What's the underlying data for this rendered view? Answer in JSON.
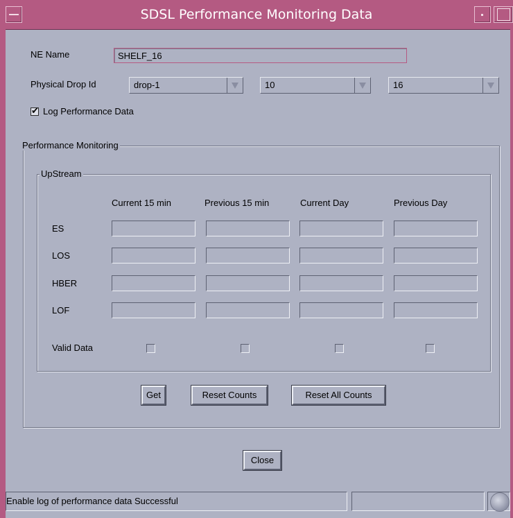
{
  "window": {
    "title": "SDSL Performance Monitoring Data"
  },
  "ne_name": {
    "label": "NE Name",
    "value": "SHELF_16"
  },
  "physical_drop": {
    "label": "Physical Drop Id",
    "combo1": "drop-1",
    "combo2": "10",
    "combo3": "16"
  },
  "log_performance": {
    "label": "Log Performance Data",
    "checked": true
  },
  "performance_monitoring": {
    "group_title": "Performance Monitoring",
    "upstream": {
      "group_title": "UpStream",
      "columns": [
        "Current 15 min",
        "Previous 15 min",
        "Current Day",
        "Previous Day"
      ],
      "rows": [
        "ES",
        "LOS",
        "HBER",
        "LOF"
      ],
      "valid_data_label": "Valid Data"
    },
    "buttons": {
      "get": "Get",
      "reset_counts": "Reset Counts",
      "reset_all_counts": "Reset All Counts"
    }
  },
  "close_button": "Close",
  "statusbar": {
    "message": "Enable log of performance data Successful",
    "aux": ""
  }
}
